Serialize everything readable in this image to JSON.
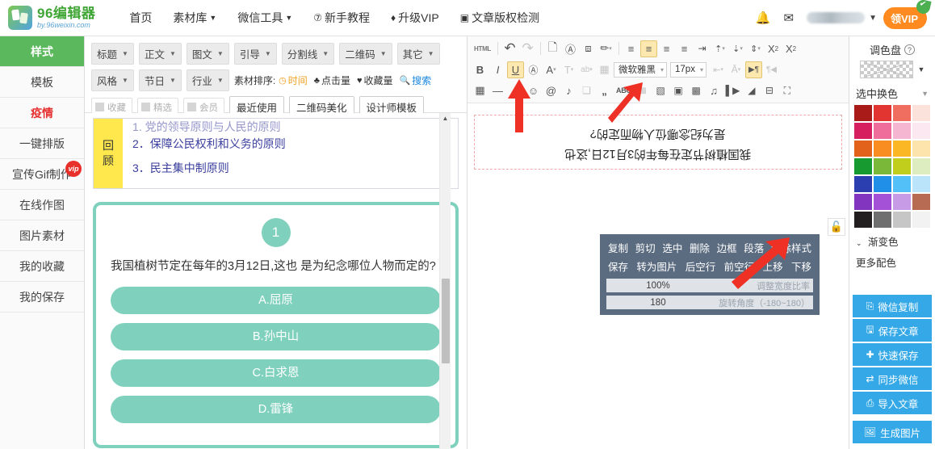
{
  "brand": {
    "title": "96编辑器",
    "subtitle": "by.96weixin.com"
  },
  "topnav": {
    "items": [
      {
        "label": "首页",
        "caret": ""
      },
      {
        "label": "素材库",
        "caret": "▼"
      },
      {
        "label": "微信工具",
        "caret": "▼"
      },
      {
        "label": "新手教程",
        "icon": "⑦"
      },
      {
        "label": "升级VIP",
        "icon": "♦"
      },
      {
        "label": "文章版权检测",
        "icon": "▣"
      }
    ],
    "bell_icon": "🔔",
    "mail_icon": "✉",
    "user_caret": "▼",
    "vip_button": "领VIP"
  },
  "sidebar": {
    "items": [
      {
        "label": "样式",
        "state": "active"
      },
      {
        "label": "模板",
        "state": ""
      },
      {
        "label": "疫情",
        "state": "alert"
      },
      {
        "label": "一键排版",
        "state": ""
      },
      {
        "label": "宣传Gif制作",
        "state": "",
        "badge": "vip"
      },
      {
        "label": "在线作图",
        "state": ""
      },
      {
        "label": "图片素材",
        "state": ""
      },
      {
        "label": "我的收藏",
        "state": ""
      },
      {
        "label": "我的保存",
        "state": ""
      }
    ]
  },
  "filterbar": {
    "row1": [
      "标题",
      "正文",
      "图文",
      "引导",
      "分割线",
      "二维码",
      "其它"
    ],
    "row2": [
      "风格",
      "节日",
      "行业"
    ],
    "sort_label": "素材排序:",
    "sort_options": [
      {
        "label": "时间",
        "icon": "◷",
        "state": "on"
      },
      {
        "label": "点击量",
        "icon": "♣",
        "state": "plain"
      },
      {
        "label": "收藏量",
        "icon": "♥",
        "state": "plain"
      },
      {
        "label": "搜索",
        "icon": "🔍",
        "state": "search"
      }
    ],
    "checks": [
      "收藏",
      "精选",
      "会员"
    ],
    "buttons": [
      "最近使用",
      "二维码美化",
      "设计师模板"
    ],
    "caret": "▼"
  },
  "preview": {
    "review_tab": [
      "回",
      "顾"
    ],
    "review_clipped": "1. 党的领导原则与人民的原则",
    "review_lines": [
      "2．保障公民权利和义务的原则",
      "3．民主集中制原则"
    ],
    "quiz": {
      "number": "1",
      "question": "我国植树节定在每年的3月12日,这也 是为纪念哪位人物而定的?",
      "options": [
        "A.屈原",
        "B.孙中山",
        "C.白求恩",
        "D.雷锋"
      ]
    },
    "scroll_arrow": "▲"
  },
  "editor": {
    "toolbar_row1": [
      {
        "name": "html-button",
        "glyph": "HTML",
        "style": "tiny"
      },
      {
        "name": "sep",
        "glyph": "|"
      },
      {
        "name": "undo-icon",
        "glyph": "↰"
      },
      {
        "name": "redo-icon",
        "glyph": "↱",
        "style": "faded"
      },
      {
        "name": "sep",
        "glyph": "|"
      },
      {
        "name": "new-document-icon",
        "glyph": "🗋"
      },
      {
        "name": "select-all-icon",
        "glyph": "ⓐ"
      },
      {
        "name": "eraser-icon",
        "glyph": "◣"
      },
      {
        "name": "format-brush-icon",
        "glyph": "✎",
        "caret": "▾"
      },
      {
        "name": "sep",
        "glyph": "|"
      },
      {
        "name": "align-left-icon",
        "glyph": "≡"
      },
      {
        "name": "align-center-icon",
        "glyph": "≡",
        "state": "sel"
      },
      {
        "name": "align-right-icon",
        "glyph": "≡"
      },
      {
        "name": "align-justify-icon",
        "glyph": "≡"
      },
      {
        "name": "indent-icon",
        "glyph": "⇥"
      },
      {
        "name": "line-height-up-icon",
        "glyph": "⇡",
        "caret": "▾"
      },
      {
        "name": "line-height-down-icon",
        "glyph": "⇣",
        "caret": "▾"
      },
      {
        "name": "paragraph-spacing-icon",
        "glyph": "⇕",
        "caret": "▾"
      },
      {
        "name": "superscript-icon",
        "glyph": "X²"
      },
      {
        "name": "subscript-icon",
        "glyph": "X₂"
      }
    ],
    "toolbar_row2": [
      {
        "name": "bold-button",
        "glyph": "B"
      },
      {
        "name": "italic-button",
        "glyph": "I"
      },
      {
        "name": "underline-button",
        "glyph": "U",
        "state": "sel"
      },
      {
        "name": "border-text-icon",
        "glyph": "Ⓐ"
      },
      {
        "name": "font-color-icon",
        "glyph": "A",
        "caret": "▾"
      },
      {
        "name": "text-background-icon",
        "glyph": "T",
        "caret": "▾"
      },
      {
        "name": "letter-case-icon",
        "glyph": "ab",
        "caret": "▾"
      },
      {
        "name": "background-image-icon",
        "glyph": "▤"
      }
    ],
    "font_family": "微软雅黑",
    "font_size": "17px",
    "toolbar_row2_tail": [
      {
        "name": "indent-box-icon",
        "glyph": "⇤",
        "caret": "▾"
      },
      {
        "name": "text-direction-icon",
        "glyph": "A",
        "caret": "▾"
      },
      {
        "name": "ltr-direction-icon",
        "glyph": "▶¶",
        "state": "sel"
      },
      {
        "name": "rtl-direction-icon",
        "glyph": "¶◀"
      }
    ],
    "toolbar_row3": [
      {
        "name": "table-icon",
        "glyph": "▦"
      },
      {
        "name": "horizontal-rule-icon",
        "glyph": "—"
      },
      {
        "name": "link-icon",
        "glyph": "⚯"
      },
      {
        "name": "emoji-icon",
        "glyph": "☺"
      },
      {
        "name": "mention-icon",
        "glyph": "@"
      },
      {
        "name": "music-link-icon",
        "glyph": "♪"
      },
      {
        "name": "layers-icon",
        "glyph": "❏"
      },
      {
        "name": "quote-icon",
        "glyph": "❞"
      },
      {
        "name": "spellcheck-abc-icon",
        "glyph": "ABC"
      },
      {
        "name": "word-import-icon",
        "glyph": "W",
        "style": "faded"
      },
      {
        "name": "image-icon",
        "glyph": "🖼"
      },
      {
        "name": "gallery-icon",
        "glyph": "🗺"
      },
      {
        "name": "qrcode-icon",
        "glyph": "▩"
      },
      {
        "name": "audio-icon",
        "glyph": "♫"
      },
      {
        "name": "video-icon",
        "glyph": "🎥"
      },
      {
        "name": "clear-format-icon",
        "glyph": "🖌"
      },
      {
        "name": "template-icon",
        "glyph": "⊟"
      },
      {
        "name": "fullscreen-icon",
        "glyph": "⛶"
      }
    ],
    "selected_text": [
      "我国植树节定在每年的3月12日,这也",
      "是为纪念哪位人物而定的?"
    ],
    "lock_icon": "🔓"
  },
  "context_menu": {
    "row1": [
      "复制",
      "剪切",
      "选中",
      "删除",
      "边框",
      "段落",
      "清除样式"
    ],
    "row2": [
      "保存",
      "转为图片",
      "后空行",
      "前空行",
      "上移",
      "下移"
    ],
    "width_slider": {
      "value": "100%",
      "label": "调整宽度比率",
      "fill": 100
    },
    "rotate_slider": {
      "value": "180",
      "label": "旋转角度（-180~180）",
      "fill": 100
    }
  },
  "palette": {
    "title": "调色盘",
    "help": "?",
    "transparent_caret": "▼",
    "selected_recolor": "选中换色",
    "selected_recolor_caret": "▼",
    "colors": [
      "#a81b18",
      "#e23430",
      "#ef6e5f",
      "#fbe3dc",
      "#d61f5f",
      "#ef6d9b",
      "#f4b6d0",
      "#fbe8f0",
      "#e2621b",
      "#f98d22",
      "#fbb724",
      "#fde3ac",
      "#179b30",
      "#79b839",
      "#c2ce1c",
      "#deedc0",
      "#2c3fb0",
      "#1f8fe8",
      "#53c0f7",
      "#b9e4f9",
      "#8236c0",
      "#a451d8",
      "#c79be6",
      "#b76b53",
      "#231f20",
      "#706f6f",
      "#c6c6c6",
      "#f2f2f2"
    ],
    "gradient_label": "渐变色",
    "gradient_caret": "⌄",
    "more_label": "更多配色"
  },
  "actions": [
    {
      "label": "微信复制",
      "icon": "⎘"
    },
    {
      "label": "保存文章",
      "icon": "🖫"
    },
    {
      "label": "快速保存",
      "icon": "✚"
    },
    {
      "label": "同步微信",
      "icon": "⇄"
    },
    {
      "label": "导入文章",
      "icon": "⎙"
    },
    {
      "label": "生成图片",
      "icon": "🖼"
    }
  ],
  "theme": {
    "green": "#5cb85c",
    "blue": "#35a9e8",
    "orange": "#ff8a1f",
    "teal": "#7fd1bd",
    "yellow": "#ffe84d",
    "menu_bg": "#5b6b80",
    "arrow_red": "#ee3124"
  }
}
